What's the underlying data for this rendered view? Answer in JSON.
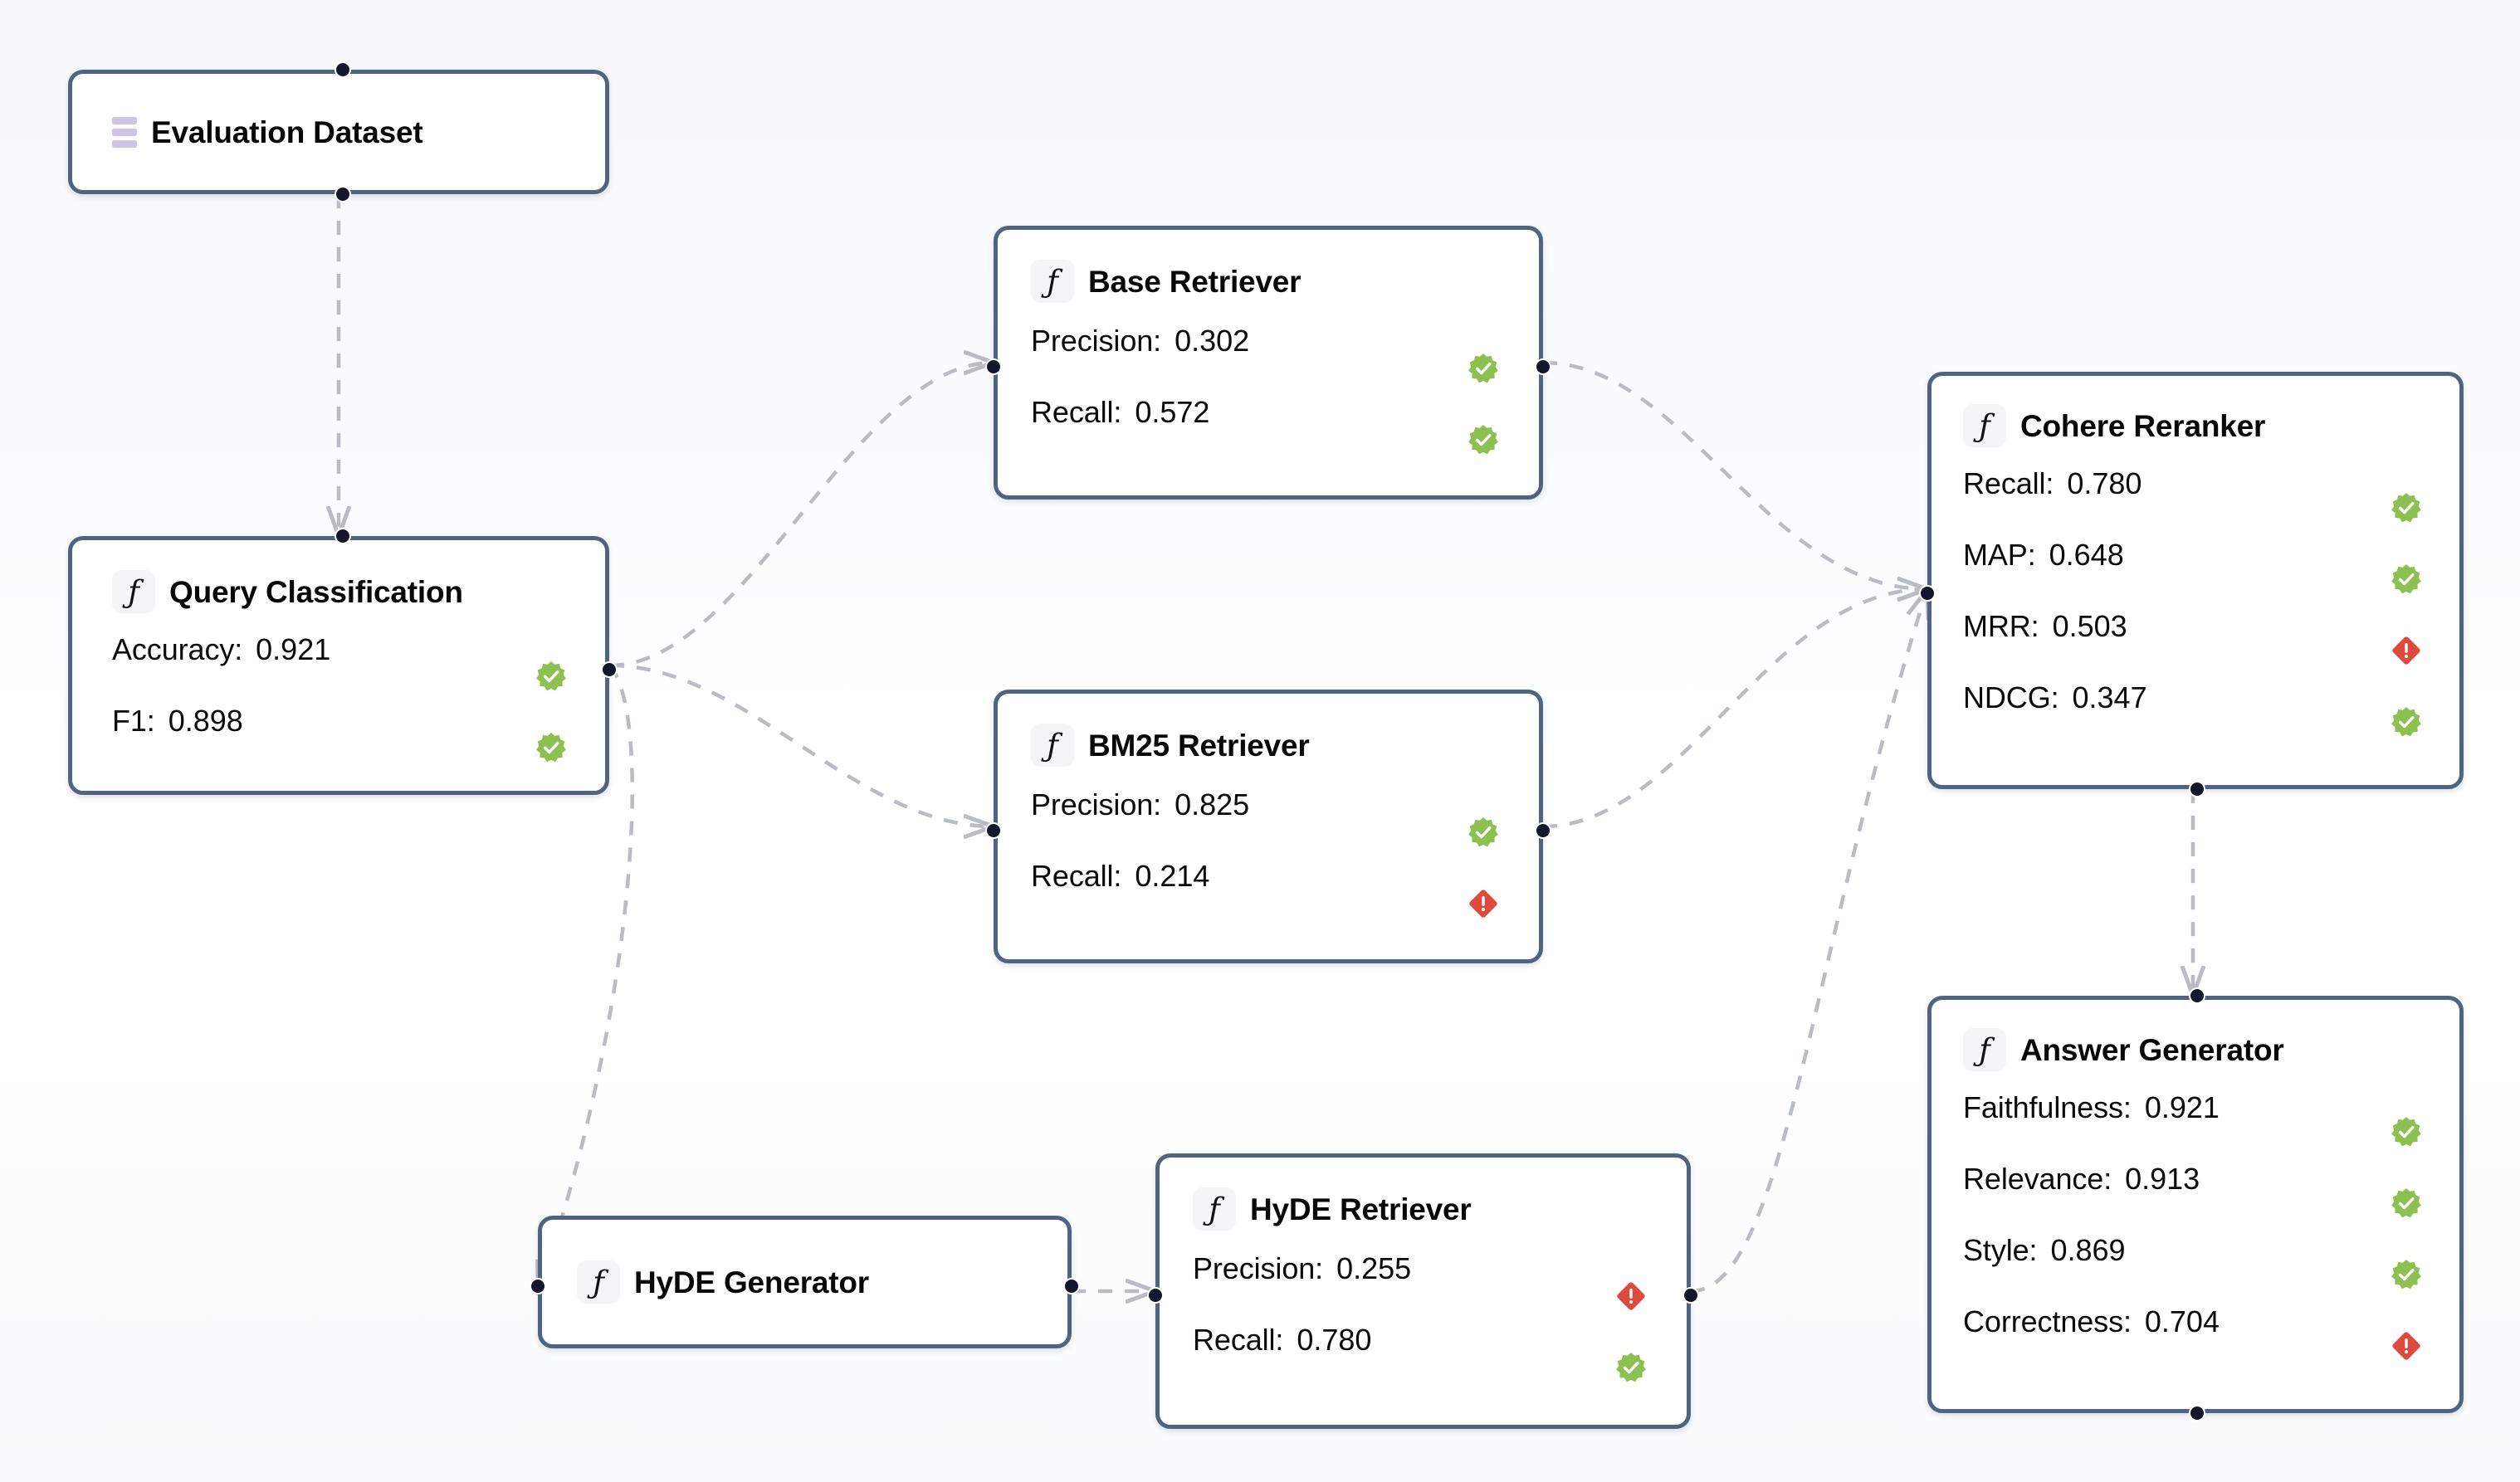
{
  "canvas": {
    "background_color": "#f8fafb",
    "grid_dot_color": "#9aa0ad",
    "node_border_color": "#4f6480",
    "edge_color": "#b9bcc3",
    "status_ok_color": "#8cc152",
    "status_alert_color": "#dd4b3e",
    "dataset_icon_color": "#cdc4e8"
  },
  "icons": {
    "function": "ƒ",
    "dataset": "dataset-bars-icon",
    "status_ok": "check-seal-icon",
    "status_alert": "alert-diamond-icon"
  },
  "nodes": [
    {
      "id": "evaluation-dataset",
      "title": "Evaluation Dataset",
      "icon": "dataset",
      "metrics": []
    },
    {
      "id": "query-classification",
      "title": "Query Classification",
      "icon": "function",
      "metrics": [
        {
          "key": "Accuracy:",
          "value": "0.921",
          "status": "ok"
        },
        {
          "key": "F1:",
          "value": "0.898",
          "status": "ok"
        }
      ]
    },
    {
      "id": "base-retriever",
      "title": "Base Retriever",
      "icon": "function",
      "metrics": [
        {
          "key": "Precision:",
          "value": "0.302",
          "status": "ok"
        },
        {
          "key": "Recall:",
          "value": "0.572",
          "status": "ok"
        }
      ]
    },
    {
      "id": "bm25-retriever",
      "title": "BM25 Retriever",
      "icon": "function",
      "metrics": [
        {
          "key": "Precision:",
          "value": "0.825",
          "status": "ok"
        },
        {
          "key": "Recall:",
          "value": "0.214",
          "status": "alert"
        }
      ]
    },
    {
      "id": "hyde-generator",
      "title": "HyDE Generator",
      "icon": "function",
      "metrics": []
    },
    {
      "id": "hyde-retriever",
      "title": "HyDE Retriever",
      "icon": "function",
      "metrics": [
        {
          "key": "Precision:",
          "value": "0.255",
          "status": "alert"
        },
        {
          "key": "Recall:",
          "value": "0.780",
          "status": "ok"
        }
      ]
    },
    {
      "id": "cohere-reranker",
      "title": "Cohere Reranker",
      "icon": "function",
      "metrics": [
        {
          "key": "Recall:",
          "value": "0.780",
          "status": "ok"
        },
        {
          "key": "MAP:",
          "value": "0.648",
          "status": "ok"
        },
        {
          "key": "MRR:",
          "value": "0.503",
          "status": "alert"
        },
        {
          "key": "NDCG:",
          "value": "0.347",
          "status": "ok"
        }
      ]
    },
    {
      "id": "answer-generator",
      "title": "Answer Generator",
      "icon": "function",
      "metrics": [
        {
          "key": "Faithfulness:",
          "value": "0.921",
          "status": "ok"
        },
        {
          "key": "Relevance:",
          "value": "0.913",
          "status": "ok"
        },
        {
          "key": "Style:",
          "value": "0.869",
          "status": "ok"
        },
        {
          "key": "Correctness:",
          "value": "0.704",
          "status": "alert"
        }
      ]
    }
  ],
  "edges": [
    {
      "from": "evaluation-dataset",
      "to": "query-classification"
    },
    {
      "from": "query-classification",
      "to": "base-retriever"
    },
    {
      "from": "query-classification",
      "to": "bm25-retriever"
    },
    {
      "from": "query-classification",
      "to": "hyde-generator"
    },
    {
      "from": "base-retriever",
      "to": "cohere-reranker"
    },
    {
      "from": "bm25-retriever",
      "to": "cohere-reranker"
    },
    {
      "from": "hyde-generator",
      "to": "hyde-retriever"
    },
    {
      "from": "hyde-retriever",
      "to": "cohere-reranker"
    },
    {
      "from": "cohere-reranker",
      "to": "answer-generator"
    }
  ]
}
